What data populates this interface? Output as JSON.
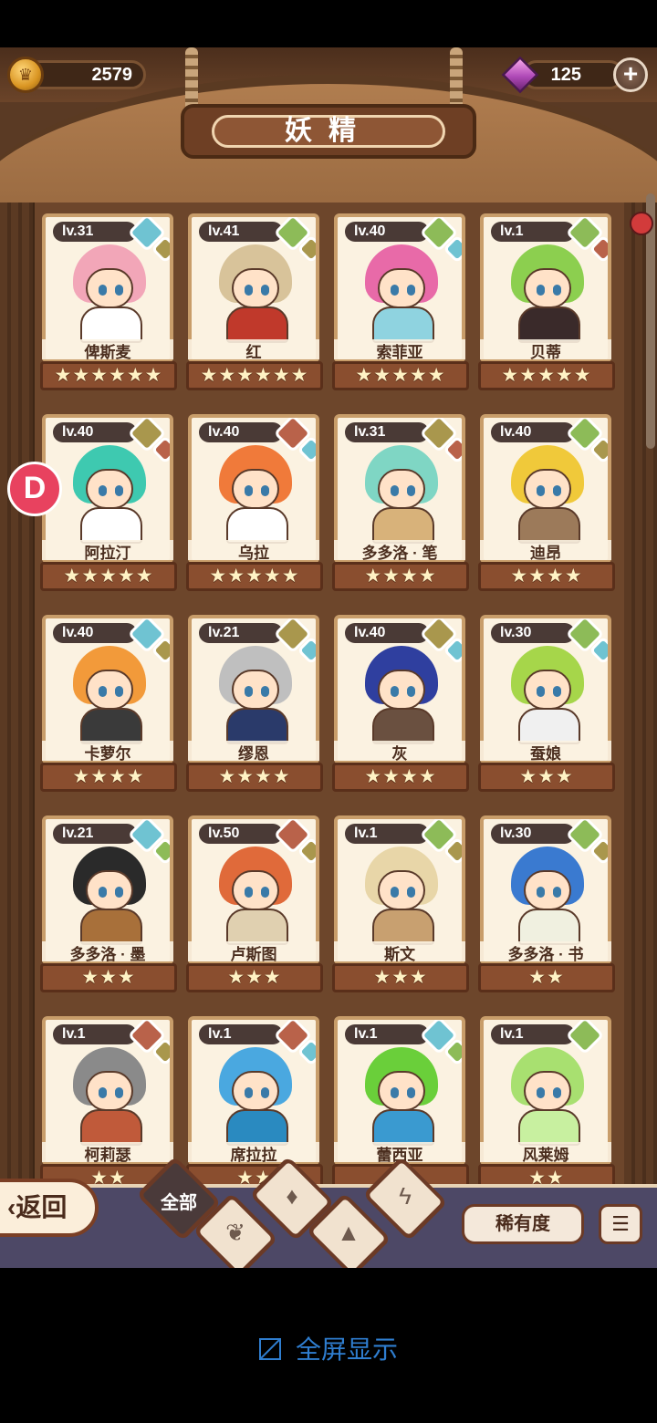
{
  "top_bar": {
    "coins": "2579",
    "gems": "125",
    "plus_symbol": "+"
  },
  "title": "妖精",
  "side_badge": "D",
  "cards": [
    {
      "level": "lv.31",
      "name": "俾斯麦",
      "stars": "★★★★★★",
      "elements": [
        "water",
        "earth"
      ],
      "hair": "#f2a6b8",
      "outfit": "#ffffff"
    },
    {
      "level": "lv.41",
      "name": "红",
      "stars": "★★★★★★",
      "elements": [
        "leaf",
        "earth"
      ],
      "hair": "#d8c39a",
      "outfit": "#c0392b"
    },
    {
      "level": "lv.40",
      "name": "索菲亚",
      "stars": "★★★★★",
      "elements": [
        "leaf",
        "water"
      ],
      "hair": "#e86aa8",
      "outfit": "#8fd3e0"
    },
    {
      "level": "lv.1",
      "name": "贝蒂",
      "stars": "★★★★★",
      "elements": [
        "leaf",
        "fire"
      ],
      "hair": "#8ccf4f",
      "outfit": "#3a2a2a"
    },
    {
      "level": "lv.40",
      "name": "阿拉汀",
      "stars": "★★★★★",
      "elements": [
        "earth",
        "fire"
      ],
      "hair": "#3ec9b0",
      "outfit": "#ffffff"
    },
    {
      "level": "lv.40",
      "name": "乌拉",
      "stars": "★★★★★",
      "elements": [
        "fire",
        "water"
      ],
      "hair": "#f07a3a",
      "outfit": "#ffffff"
    },
    {
      "level": "lv.31",
      "name": "多多洛 · 笔",
      "stars": "★★★★",
      "elements": [
        "earth",
        "fire"
      ],
      "hair": "#7fd6c4",
      "outfit": "#d8b27a"
    },
    {
      "level": "lv.40",
      "name": "迪昂",
      "stars": "★★★★",
      "elements": [
        "leaf",
        "earth"
      ],
      "hair": "#f0c93a",
      "outfit": "#9c7a5a"
    },
    {
      "level": "lv.40",
      "name": "卡萝尔",
      "stars": "★★★★",
      "elements": [
        "water",
        "earth"
      ],
      "hair": "#f29a3a",
      "outfit": "#3a3a3a"
    },
    {
      "level": "lv.21",
      "name": "缪恩",
      "stars": "★★★★",
      "elements": [
        "earth",
        "water"
      ],
      "hair": "#bfbfbf",
      "outfit": "#2a3a6a"
    },
    {
      "level": "lv.40",
      "name": "灰",
      "stars": "★★★★",
      "elements": [
        "earth",
        "water"
      ],
      "hair": "#2f3f9f",
      "outfit": "#6a5040"
    },
    {
      "level": "lv.30",
      "name": "蚕娘",
      "stars": "★★★",
      "elements": [
        "leaf",
        "water"
      ],
      "hair": "#a6d64a",
      "outfit": "#f0f0f0"
    },
    {
      "level": "lv.21",
      "name": "多多洛 · 墨",
      "stars": "★★★",
      "elements": [
        "water",
        "leaf"
      ],
      "hair": "#2a2a2a",
      "outfit": "#a8703a"
    },
    {
      "level": "lv.50",
      "name": "卢斯图",
      "stars": "★★★",
      "elements": [
        "fire",
        "earth"
      ],
      "hair": "#e06a3a",
      "outfit": "#e0d0b0"
    },
    {
      "level": "lv.1",
      "name": "斯文",
      "stars": "★★★",
      "elements": [
        "leaf",
        "earth"
      ],
      "hair": "#e8d6a8",
      "outfit": "#c8a070"
    },
    {
      "level": "lv.30",
      "name": "多多洛 · 书",
      "stars": "★★",
      "elements": [
        "leaf",
        "earth"
      ],
      "hair": "#3a7ad0",
      "outfit": "#f0f0e0"
    },
    {
      "level": "lv.1",
      "name": "柯莉瑟",
      "stars": "★★",
      "elements": [
        "fire",
        "earth"
      ],
      "hair": "#8a8a8a",
      "outfit": "#c05a3a"
    },
    {
      "level": "lv.1",
      "name": "席拉拉",
      "stars": "★★",
      "elements": [
        "fire",
        "water"
      ],
      "hair": "#4aa8e0",
      "outfit": "#2a8ac0"
    },
    {
      "level": "lv.1",
      "name": "蕾西亚",
      "stars": "★★",
      "elements": [
        "water",
        "leaf"
      ],
      "hair": "#6acf3a",
      "outfit": "#3a9ad0"
    },
    {
      "level": "lv.1",
      "name": "风莱姆",
      "stars": "★★",
      "elements": [
        "leaf"
      ],
      "hair": "#a8e070",
      "outfit": "#c8f0a0"
    }
  ],
  "bottom_bar": {
    "back_label": "返回",
    "filter_all_label": "全部",
    "filters": [
      "leaf",
      "water",
      "earth",
      "fire"
    ],
    "rarity_label": "稀有度"
  },
  "fullscreen_label": "全屏显示"
}
